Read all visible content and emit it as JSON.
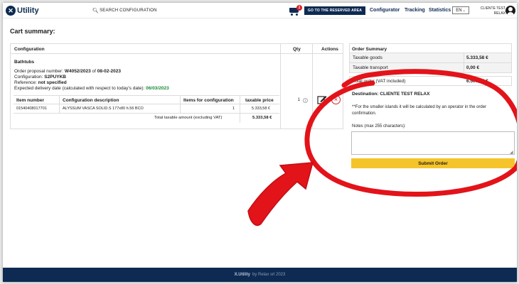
{
  "header": {
    "logo_mark": "✕",
    "logo_text": "Utility",
    "search_label": "SEARCH CONFIGURATION",
    "cart_count": "1",
    "reserved_area": "GO TO THE RESERVED AREA",
    "nav": [
      "Configurator",
      "Tracking",
      "Statistics"
    ],
    "language": "EN",
    "user_line1": "CLIENTE TEST",
    "user_line2": "RELAX"
  },
  "page_title": "Cart summary:",
  "configuration": {
    "headers": {
      "configuration": "Configuration",
      "qty": "Qty",
      "actions": "Actions"
    },
    "group": "Bathtubs",
    "order_proposal_label": "Order proposal number:",
    "order_proposal_number": "W4052/2023",
    "of": "of",
    "order_date": "08-02-2023",
    "configuration_label": "Configuration:",
    "configuration_code": "S2PUYKB",
    "reference_label": "Reference:",
    "reference_value": "not specified",
    "delivery_label": "Expected delivery date (calculated with respect to today's date):",
    "delivery_date": "06/03/2023",
    "qty": "1",
    "items": {
      "columns": [
        "Item number",
        "Configuration description",
        "Items for configuration",
        "taxable price"
      ],
      "rows": [
        {
          "item_number": "01540408017701",
          "description": "ALYSSUM VASCA SOLID.S 177x80 h.56 BCO",
          "items": "1",
          "price": "5.333,58 €"
        }
      ],
      "total_label": "Total taxable amount (excluding VAT)",
      "total_value": "5.333,58 €"
    }
  },
  "summary": {
    "title": "Order Summary",
    "taxable_goods_label": "Taxable goods",
    "taxable_goods_value": "5.333,58 €",
    "taxable_transport_label": "Taxable transport",
    "taxable_transport_value": "0,00 €",
    "total_label": "Total order (VAT included)",
    "total_value": "6.506,97 €",
    "destination": "Destination: CLIENTE TEST RELAX",
    "island_note": "**For the smaller islands it will be calculated by an operator in the order confirmation.",
    "notes_label": "Notes (max 255 characters):",
    "notes_value": "",
    "submit_label": "Submit Order"
  },
  "annotation": {
    "circle_color": "#e3131a",
    "arrow_color": "#e3131a"
  },
  "footer": {
    "brand": "X.Utility",
    "text": "by Relax srl 2023"
  }
}
